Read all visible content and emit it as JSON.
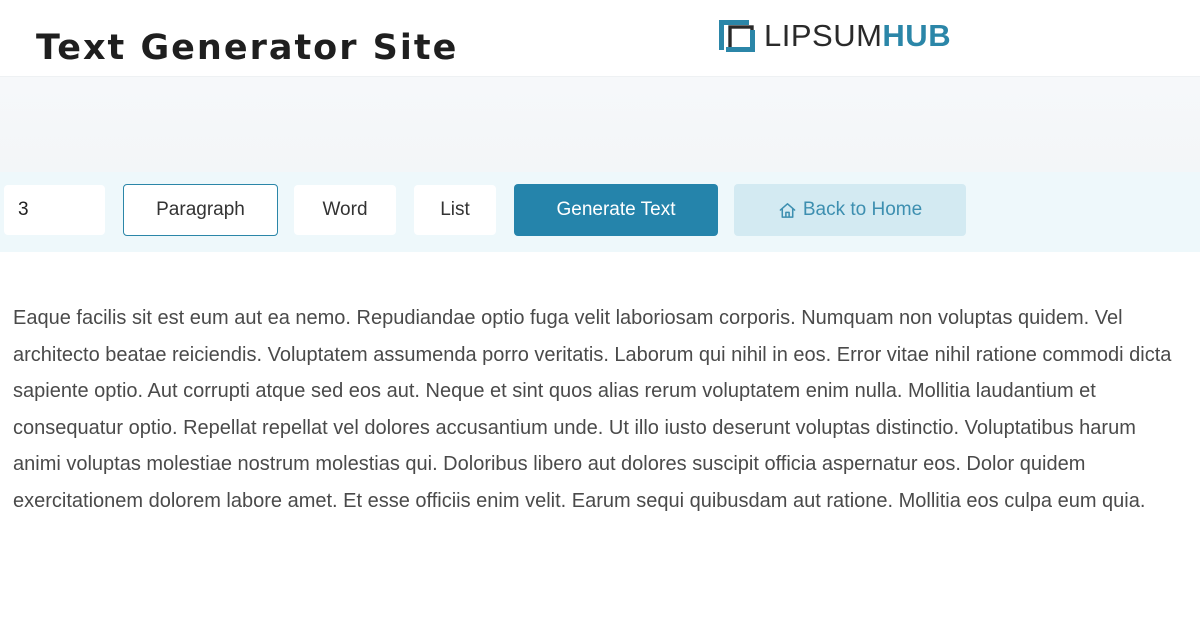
{
  "header": {
    "title": "Text Generator Site",
    "brand": {
      "name_part1": "LIPSUM",
      "name_part2": "HUB",
      "icon": "lipsumhub-logo-icon"
    }
  },
  "colors": {
    "accent": "#2584ab",
    "home_button_bg": "#d3eaf2",
    "toolbar_bg": "#eef8fb"
  },
  "toolbar": {
    "count_value": "3",
    "options": [
      {
        "label": "Paragraph",
        "selected": true
      },
      {
        "label": "Word",
        "selected": false
      },
      {
        "label": "List",
        "selected": false
      }
    ],
    "generate_label": "Generate Text",
    "home_label": "Back to Home",
    "home_icon": "home-icon"
  },
  "content": {
    "text": "Eaque facilis sit est eum aut ea nemo. Repudiandae optio fuga velit laboriosam corporis. Numquam non voluptas quidem. Vel architecto beatae reiciendis. Voluptatem assumenda porro veritatis. Laborum qui nihil in eos. Error vitae nihil ratione commodi dicta sapiente optio. Aut corrupti atque sed eos aut. Neque et sint quos alias rerum voluptatem enim nulla. Mollitia laudantium et consequatur optio. Repellat repellat vel dolores accusantium unde. Ut illo iusto deserunt voluptas distinctio. Voluptatibus harum animi voluptas molestiae nostrum molestias qui. Doloribus libero aut dolores suscipit officia aspernatur eos. Dolor quidem exercitationem dolorem labore amet. Et esse officiis enim velit. Earum sequi quibusdam aut ratione. Mollitia eos culpa eum quia."
  }
}
